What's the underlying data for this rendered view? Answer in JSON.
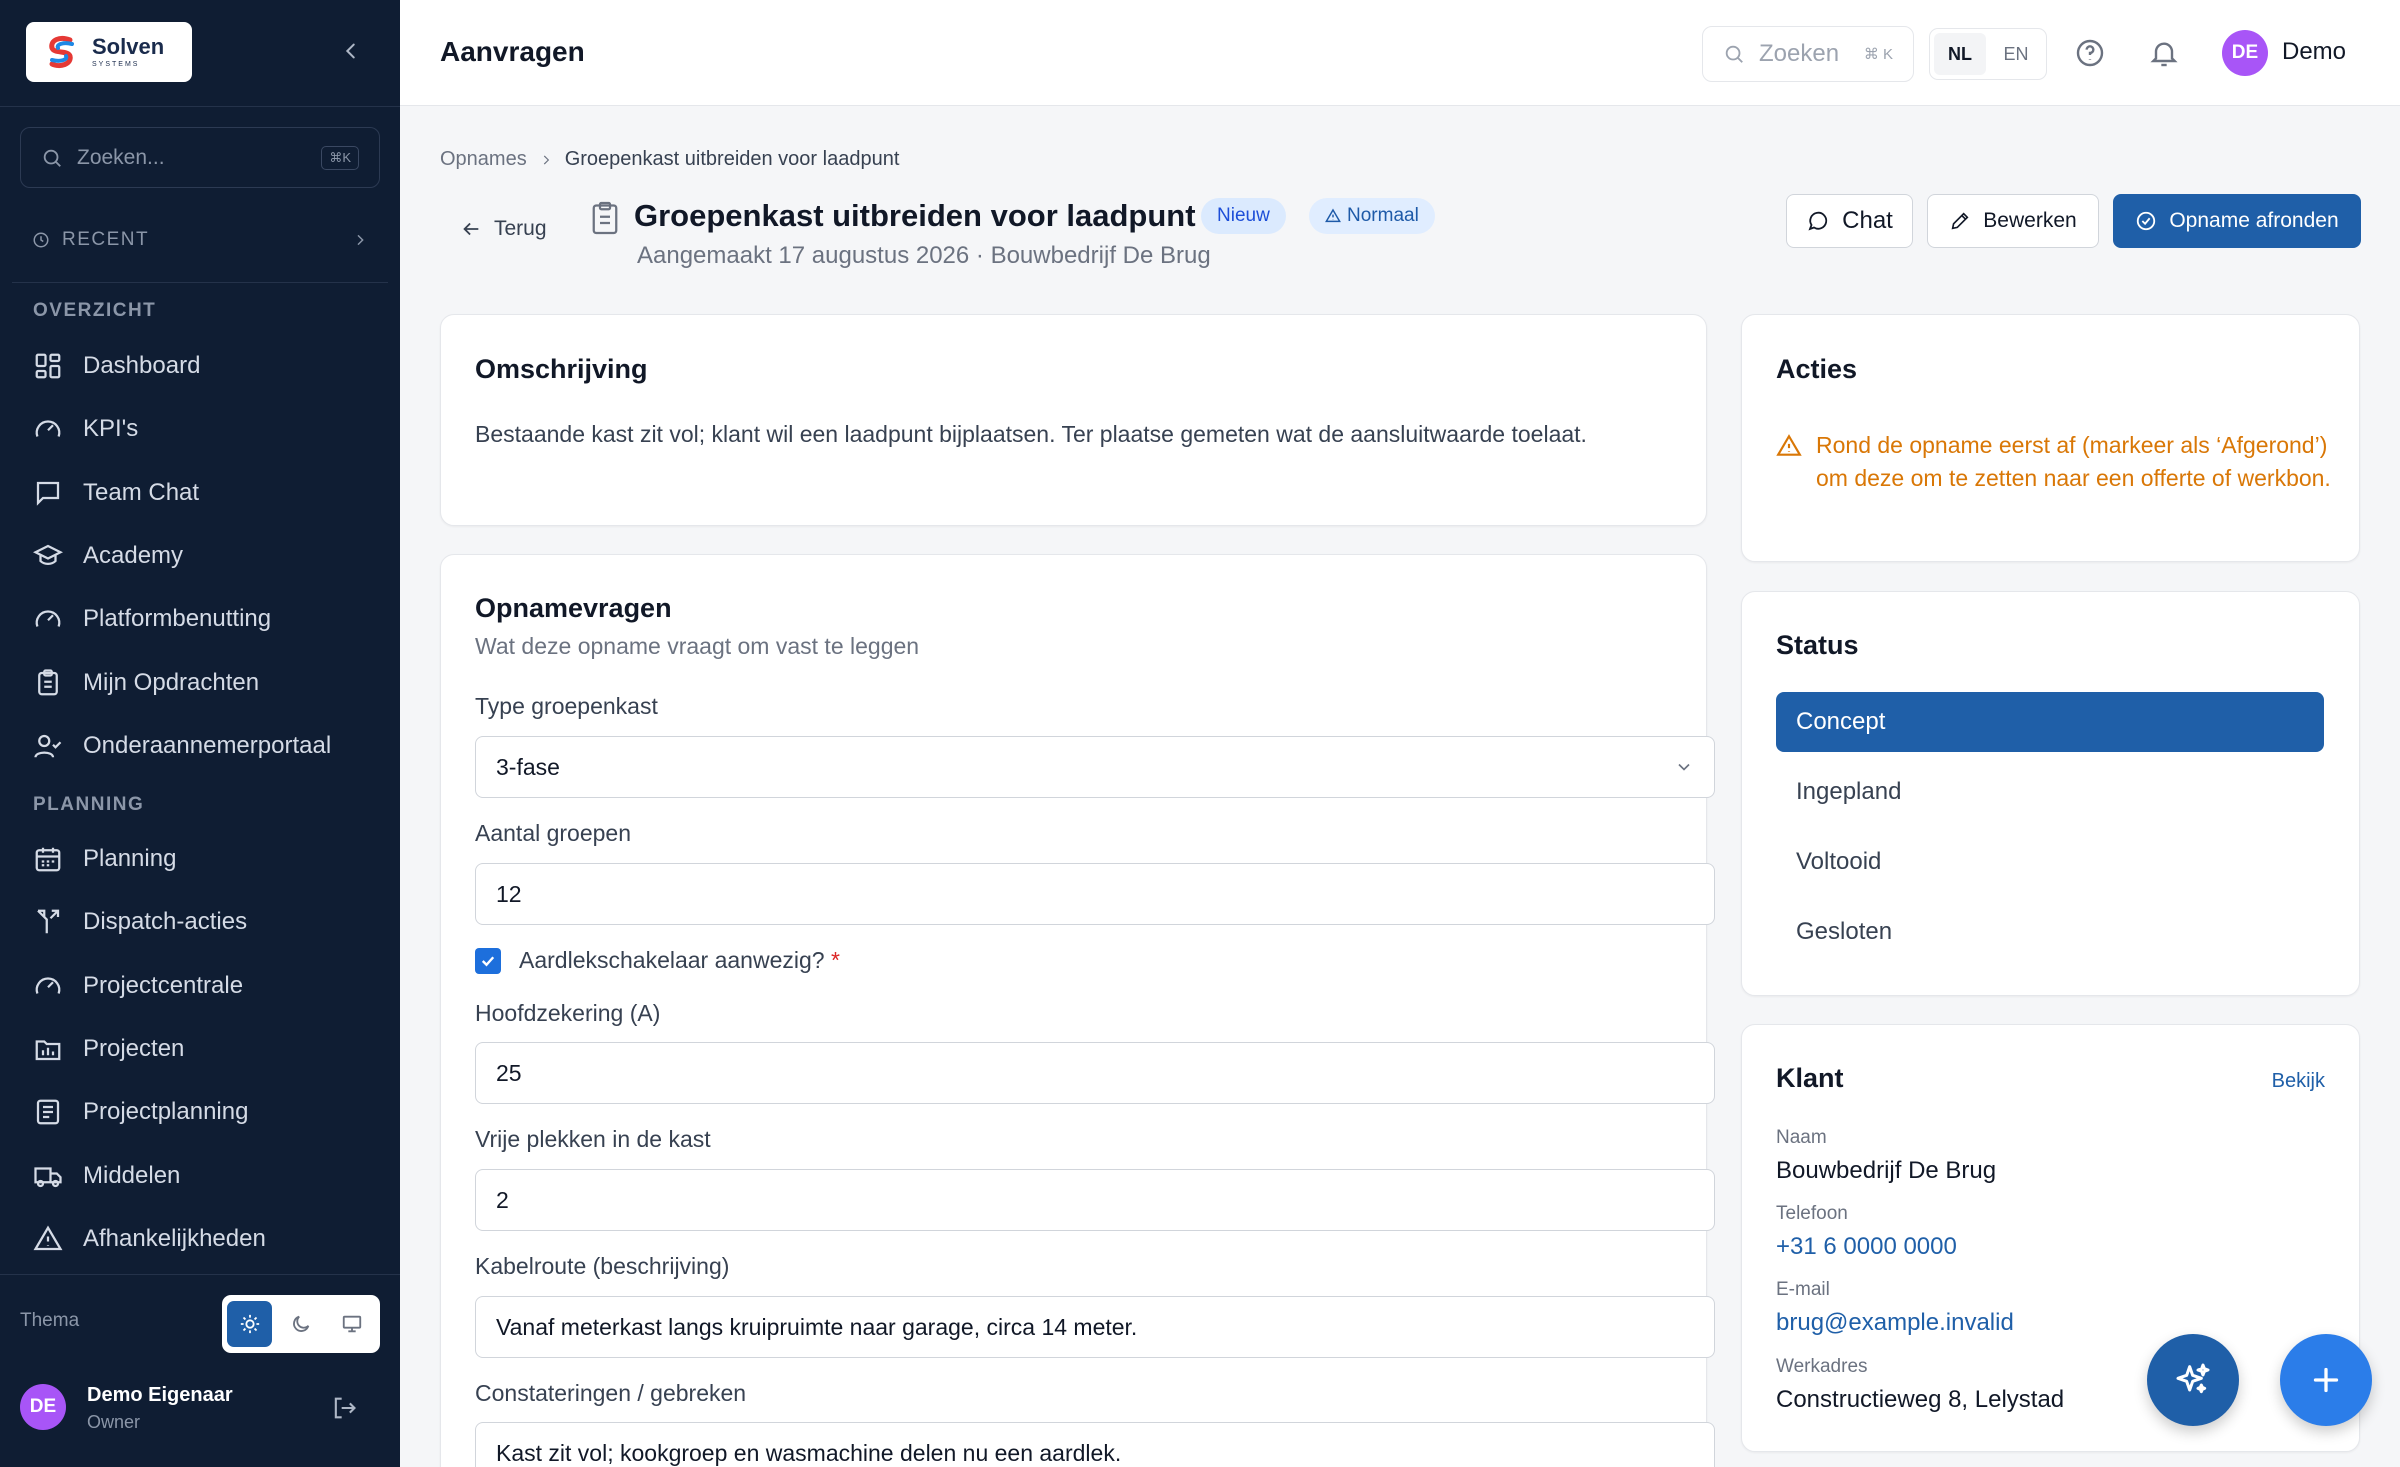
{
  "sidebar": {
    "logo": {
      "name": "Solven",
      "tagline": "SYSTEMS"
    },
    "search": {
      "placeholder": "Zoeken...",
      "shortcut": "⌘K"
    },
    "recent_label": "RECENT",
    "sections": [
      {
        "title": "OVERZICHT",
        "items": [
          {
            "label": "Dashboard",
            "icon": "dashboard-icon"
          },
          {
            "label": "KPI's",
            "icon": "gauge-icon"
          },
          {
            "label": "Team Chat",
            "icon": "message-square-icon"
          },
          {
            "label": "Academy",
            "icon": "graduation-cap-icon"
          },
          {
            "label": "Platformbenutting",
            "icon": "gauge-icon"
          },
          {
            "label": "Mijn Opdrachten",
            "icon": "clipboard-icon"
          },
          {
            "label": "Onderaannemerportaal",
            "icon": "user-check-icon"
          }
        ]
      },
      {
        "title": "PLANNING",
        "items": [
          {
            "label": "Planning",
            "icon": "calendar-icon"
          },
          {
            "label": "Dispatch-acties",
            "icon": "route-icon"
          },
          {
            "label": "Projectcentrale",
            "icon": "gauge-icon"
          },
          {
            "label": "Projecten",
            "icon": "folder-chart-icon"
          },
          {
            "label": "Projectplanning",
            "icon": "list-icon"
          },
          {
            "label": "Middelen",
            "icon": "truck-icon"
          },
          {
            "label": "Afhankelijkheden",
            "icon": "alert-triangle-icon"
          }
        ]
      }
    ],
    "theme_label": "Thema",
    "user": {
      "initials": "DE",
      "name": "Demo Eigenaar",
      "role": "Owner"
    }
  },
  "topbar": {
    "title": "Aanvragen",
    "search_placeholder": "Zoeken",
    "search_shortcut": "⌘ K",
    "languages": [
      "NL",
      "EN"
    ],
    "active_language": "NL",
    "user_initials": "DE",
    "user_name": "Demo"
  },
  "page": {
    "breadcrumb": [
      "Opnames",
      "Groepenkast uitbreiden voor laadpunt"
    ],
    "back_label": "Terug",
    "title": "Groepenkast uitbreiden voor laadpunt",
    "badge_status": "Nieuw",
    "badge_priority": "Normaal",
    "subtitle": "Aangemaakt 17 augustus 2026 · Bouwbedrijf De Brug",
    "actions": {
      "chat": "Chat",
      "edit": "Bewerken",
      "complete": "Opname afronden"
    }
  },
  "description": {
    "title": "Omschrijving",
    "text": "Bestaande kast zit vol; klant wil een laadpunt bijplaatsen. Ter plaatse gemeten wat de aansluitwaarde toelaat."
  },
  "questions": {
    "title": "Opnamevragen",
    "subtitle": "Wat deze opname vraagt om vast te leggen",
    "fields": {
      "type": {
        "label": "Type groepenkast",
        "value": "3-fase"
      },
      "groups": {
        "label": "Aantal groepen",
        "value": "12"
      },
      "rcd": {
        "label": "Aardlekschakelaar aanwezig?",
        "required": "*",
        "checked": true
      },
      "main_fuse": {
        "label": "Hoofdzekering (A)",
        "value": "25"
      },
      "free_slots": {
        "label": "Vrije plekken in de kast",
        "value": "2"
      },
      "cable_route": {
        "label": "Kabelroute (beschrijving)",
        "value": "Vanaf meterkast langs kruipruimte naar garage, circa 14 meter."
      },
      "findings": {
        "label": "Constateringen / gebreken",
        "value": "Kast zit vol; kookgroep en wasmachine delen nu een aardlek."
      }
    }
  },
  "actions_card": {
    "title": "Acties",
    "warning": "Rond de opname eerst af (markeer als ‘Afgerond’) om deze om te zetten naar een offerte of werkbon."
  },
  "status_card": {
    "title": "Status",
    "items": [
      "Concept",
      "Ingepland",
      "Voltooid",
      "Gesloten"
    ],
    "active": "Concept"
  },
  "client_card": {
    "title": "Klant",
    "link": "Bekijk",
    "name_label": "Naam",
    "name": "Bouwbedrijf De Brug",
    "phone_label": "Telefoon",
    "phone": "+31 6 0000 0000",
    "email_label": "E-mail",
    "email": "brug@example.invalid",
    "address_label": "Werkadres",
    "address": "Constructieweg 8, Lelystad"
  },
  "colors": {
    "sidebar_bg": "#0f1d33",
    "primary": "#1f5fa8",
    "warning": "#d97706",
    "avatar": "#a855f7"
  }
}
